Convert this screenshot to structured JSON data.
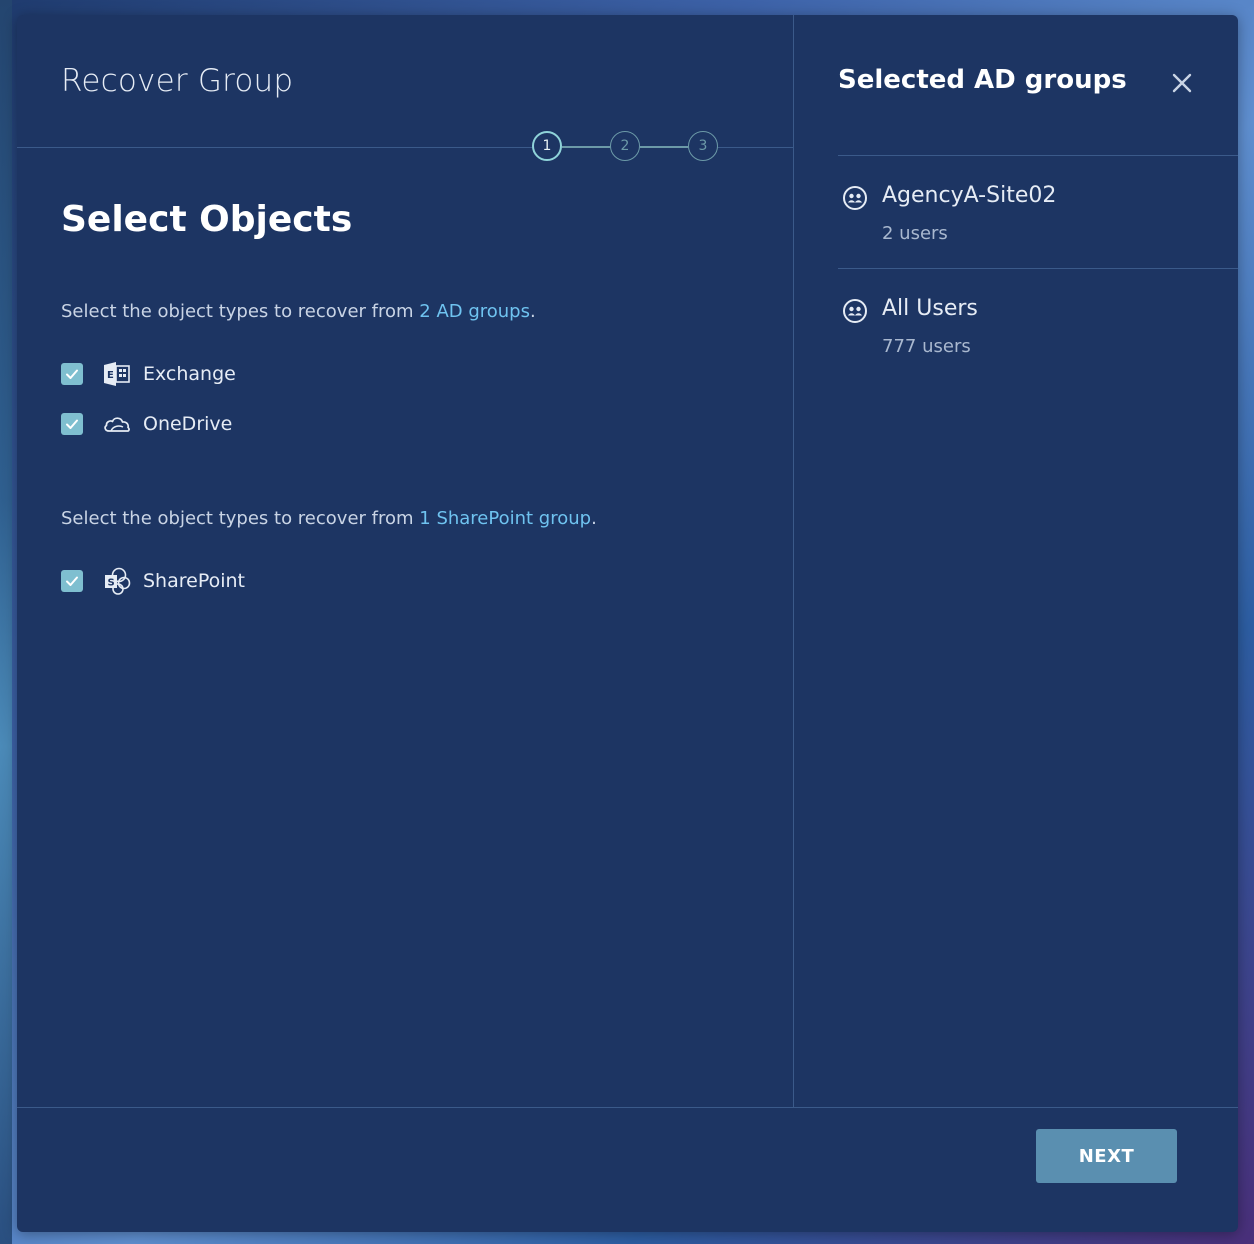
{
  "dialog": {
    "title": "Recover Group",
    "stepper": {
      "steps": [
        "1",
        "2",
        "3"
      ],
      "active_step": "1"
    },
    "heading": "Select Objects",
    "ad_section": {
      "text_prefix": "Select the object types to recover from ",
      "link": "2 AD groups",
      "text_suffix": ".",
      "items": [
        {
          "label": "Exchange",
          "checked": true,
          "icon": "exchange-icon"
        },
        {
          "label": "OneDrive",
          "checked": true,
          "icon": "onedrive-icon"
        }
      ]
    },
    "sp_section": {
      "text_prefix": "Select the object types to recover from ",
      "link": "1 SharePoint group",
      "text_suffix": ".",
      "items": [
        {
          "label": "SharePoint",
          "checked": true,
          "icon": "sharepoint-icon"
        }
      ]
    },
    "side_panel": {
      "title": "Selected AD groups",
      "groups": [
        {
          "name": "AgencyA-Site02",
          "count": "2 users"
        },
        {
          "name": "All Users",
          "count": "777 users"
        }
      ]
    },
    "footer": {
      "next_label": "NEXT"
    }
  },
  "colors": {
    "dialog_bg": "#1d3563",
    "link": "#6fc3f0",
    "checkbox": "#7fbfd0",
    "step_active": "#8fd3d9",
    "button": "#5a8fb0"
  }
}
